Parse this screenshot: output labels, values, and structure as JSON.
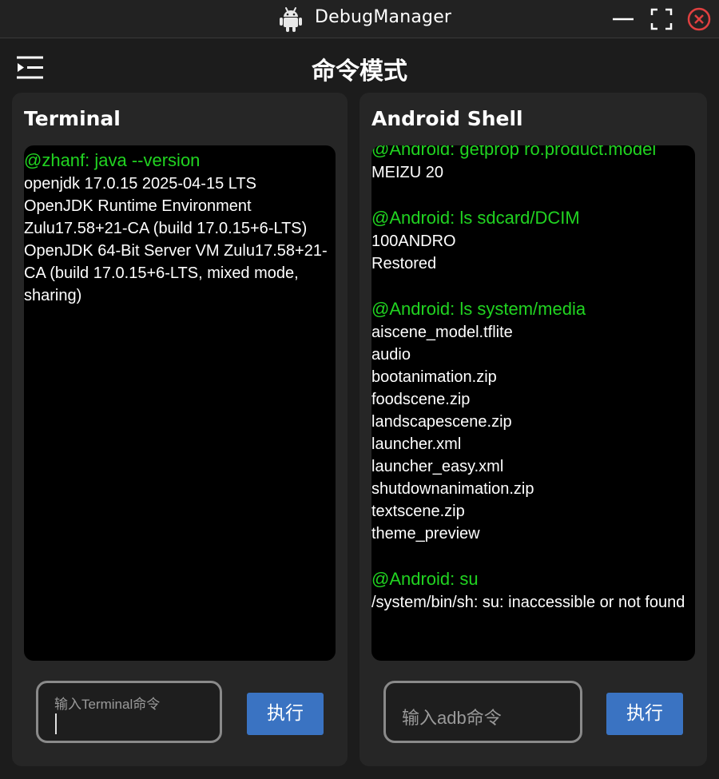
{
  "window": {
    "title": "DebugManager",
    "icons": {
      "app": "android-icon",
      "minimize": "minimize-icon",
      "maximize": "maximize-icon",
      "close": "close-icon"
    }
  },
  "header": {
    "title": "命令模式",
    "menu_icon": "sidebar-toggle-icon"
  },
  "colors": {
    "background": "#1c1c1c",
    "panel": "#262626",
    "terminal": "#000000",
    "command_text": "#21d421",
    "output_text": "#ffffff",
    "button": "#3a73c2",
    "close_red": "#e04040"
  },
  "terminal_panel": {
    "title": "Terminal",
    "lines": [
      {
        "type": "cmd",
        "text": "@zhanf: java --version"
      },
      {
        "type": "out",
        "text": "openjdk 17.0.15 2025-04-15 LTS"
      },
      {
        "type": "out",
        "text": "OpenJDK Runtime Environment Zulu17.58+21-CA (build 17.0.15+6-LTS)"
      },
      {
        "type": "out",
        "text": "OpenJDK 64-Bit Server VM Zulu17.58+21-CA (build 17.0.15+6-LTS, mixed mode, sharing)"
      }
    ],
    "input_placeholder": "输入Terminal命令",
    "execute_label": "执行"
  },
  "shell_panel": {
    "title": "Android Shell",
    "lines": [
      {
        "type": "cmd",
        "text": "@Android: getprop ro.product.model"
      },
      {
        "type": "out",
        "text": "MEIZU 20"
      },
      {
        "type": "blank",
        "text": ""
      },
      {
        "type": "cmd",
        "text": "@Android: ls sdcard/DCIM"
      },
      {
        "type": "out",
        "text": "100ANDRO"
      },
      {
        "type": "out",
        "text": "Restored"
      },
      {
        "type": "blank",
        "text": ""
      },
      {
        "type": "cmd",
        "text": "@Android: ls system/media"
      },
      {
        "type": "out",
        "text": "aiscene_model.tflite"
      },
      {
        "type": "out",
        "text": "audio"
      },
      {
        "type": "out",
        "text": "bootanimation.zip"
      },
      {
        "type": "out",
        "text": "foodscene.zip"
      },
      {
        "type": "out",
        "text": "landscapescene.zip"
      },
      {
        "type": "out",
        "text": "launcher.xml"
      },
      {
        "type": "out",
        "text": "launcher_easy.xml"
      },
      {
        "type": "out",
        "text": "shutdownanimation.zip"
      },
      {
        "type": "out",
        "text": "textscene.zip"
      },
      {
        "type": "out",
        "text": "theme_preview"
      },
      {
        "type": "blank",
        "text": ""
      },
      {
        "type": "cmd",
        "text": "@Android: su"
      },
      {
        "type": "out",
        "text": "/system/bin/sh: su: inaccessible or not found"
      }
    ],
    "input_placeholder": "输入adb命令",
    "execute_label": "执行"
  }
}
